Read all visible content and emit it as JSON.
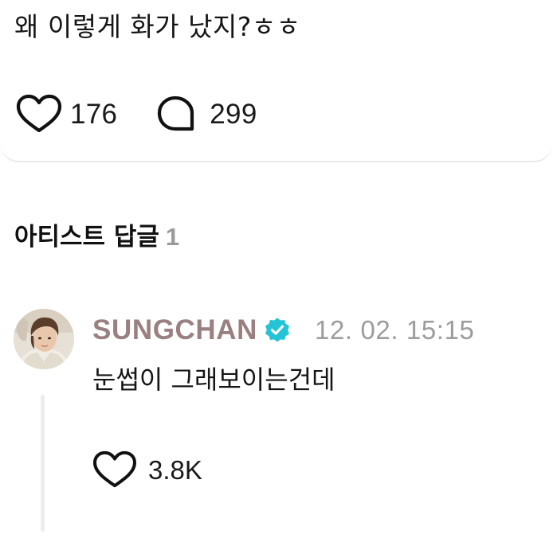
{
  "post": {
    "text": "왜 이렇게 화가 났지?ㅎㅎ",
    "likes": "176",
    "comments": "299",
    "like_icon": "heart-outline-icon",
    "comment_icon": "speech-bubble-icon"
  },
  "artist_replies": {
    "title": "아티스트 답글",
    "count": "1"
  },
  "reply": {
    "author": "SUNGCHAN",
    "verified_icon": "verified-badge-icon",
    "verified_color": "#23c4d6",
    "author_color": "#9a8080",
    "timestamp": "12. 02. 15:15",
    "text": "눈썹이 그래보이는건데",
    "likes": "3.8K",
    "like_icon": "heart-outline-icon"
  }
}
